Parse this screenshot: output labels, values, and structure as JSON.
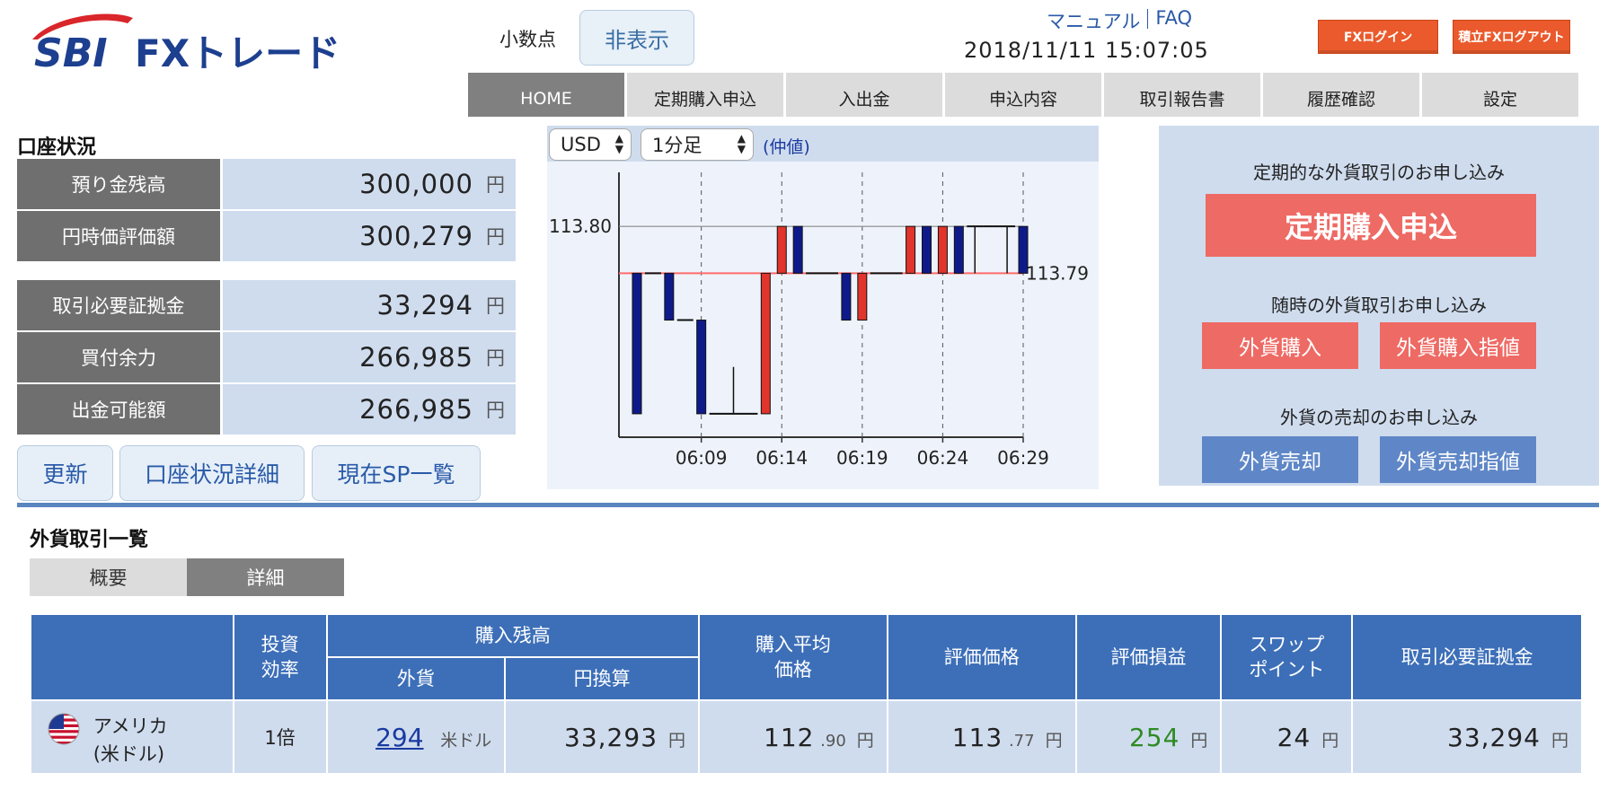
{
  "header": {
    "logo_sbi": "SBI",
    "logo_text": "FXトレード",
    "decimal_label": "小数点",
    "decimal_toggle": "非表示",
    "manual_link": "マニュアル",
    "faq_link": "FAQ",
    "datetime": "2018/11/11 15:07:05",
    "login_button": "FXログイン",
    "logout_button": "積立FXログアウト",
    "colors": {
      "brand_blue": "#1d3f8f",
      "brand_red": "#d9262a",
      "header_button": "#ea5a2c"
    }
  },
  "nav": {
    "tabs": [
      {
        "label": "HOME",
        "active": true
      },
      {
        "label": "定期購入申込",
        "active": false
      },
      {
        "label": "入出金",
        "active": false
      },
      {
        "label": "申込内容",
        "active": false
      },
      {
        "label": "取引報告書",
        "active": false
      },
      {
        "label": "履歴確認",
        "active": false
      },
      {
        "label": "設定",
        "active": false
      }
    ]
  },
  "account": {
    "title": "口座状況",
    "rows": [
      {
        "label": "預り金残高",
        "value": "300,000",
        "unit": "円"
      },
      {
        "label": "円時価評価額",
        "value": "300,279",
        "unit": "円"
      },
      {
        "label": "取引必要証拠金",
        "value": "33,294",
        "unit": "円"
      },
      {
        "label": "買付余力",
        "value": "266,985",
        "unit": "円"
      },
      {
        "label": "出金可能額",
        "value": "266,985",
        "unit": "円"
      }
    ],
    "buttons": {
      "refresh": "更新",
      "detail": "口座状況詳細",
      "sp_list": "現在SP一覧"
    }
  },
  "chart_controls": {
    "currency": "USD",
    "timeframe": "1分足",
    "price_type": "(仲値)"
  },
  "chart_data": {
    "type": "candlestick",
    "y_tick_label": "113.80",
    "current_price_label": "113.79",
    "current_price": 113.79,
    "x_tick_labels": [
      "06:09",
      "06:14",
      "06:19",
      "06:24",
      "06:29"
    ],
    "grid": "vertical dashed at x ticks",
    "colors": {
      "up": "#e0342c",
      "down": "#0f1a8a",
      "flat": "#111111",
      "current_line": "#ff6b6b"
    },
    "candles": [
      {
        "o": 113.79,
        "c": 113.76,
        "h": 113.79,
        "l": 113.76
      },
      {
        "o": 113.79,
        "c": 113.79,
        "h": 113.79,
        "l": 113.79
      },
      {
        "o": 113.79,
        "c": 113.78,
        "h": 113.79,
        "l": 113.78
      },
      {
        "o": 113.78,
        "c": 113.78,
        "h": 113.78,
        "l": 113.78
      },
      {
        "o": 113.78,
        "c": 113.76,
        "h": 113.78,
        "l": 113.76
      },
      {
        "o": 113.76,
        "c": 113.76,
        "h": 113.76,
        "l": 113.76
      },
      {
        "o": 113.76,
        "c": 113.76,
        "h": 113.77,
        "l": 113.76
      },
      {
        "o": 113.76,
        "c": 113.76,
        "h": 113.76,
        "l": 113.76
      },
      {
        "o": 113.76,
        "c": 113.79,
        "h": 113.79,
        "l": 113.76
      },
      {
        "o": 113.79,
        "c": 113.8,
        "h": 113.8,
        "l": 113.79
      },
      {
        "o": 113.8,
        "c": 113.79,
        "h": 113.8,
        "l": 113.79
      },
      {
        "o": 113.79,
        "c": 113.79,
        "h": 113.79,
        "l": 113.79
      },
      {
        "o": 113.79,
        "c": 113.79,
        "h": 113.79,
        "l": 113.79
      },
      {
        "o": 113.79,
        "c": 113.78,
        "h": 113.79,
        "l": 113.78
      },
      {
        "o": 113.78,
        "c": 113.79,
        "h": 113.79,
        "l": 113.78
      },
      {
        "o": 113.79,
        "c": 113.79,
        "h": 113.79,
        "l": 113.79
      },
      {
        "o": 113.79,
        "c": 113.79,
        "h": 113.79,
        "l": 113.79
      },
      {
        "o": 113.79,
        "c": 113.8,
        "h": 113.8,
        "l": 113.79
      },
      {
        "o": 113.8,
        "c": 113.79,
        "h": 113.8,
        "l": 113.79
      },
      {
        "o": 113.79,
        "c": 113.8,
        "h": 113.8,
        "l": 113.79
      },
      {
        "o": 113.8,
        "c": 113.79,
        "h": 113.8,
        "l": 113.79
      },
      {
        "o": 113.8,
        "c": 113.8,
        "h": 113.8,
        "l": 113.79
      },
      {
        "o": 113.8,
        "c": 113.8,
        "h": 113.8,
        "l": 113.8
      },
      {
        "o": 113.8,
        "c": 113.8,
        "h": 113.8,
        "l": 113.79
      },
      {
        "o": 113.8,
        "c": 113.79,
        "h": 113.8,
        "l": 113.79
      }
    ]
  },
  "order_panel": {
    "periodic_caption": "定期的な外貨取引のお申し込み",
    "periodic_button": "定期購入申込",
    "spot_caption": "随時の外貨取引お申し込み",
    "buy_button": "外貨購入",
    "buy_limit_button": "外貨購入指値",
    "sell_caption": "外貨の売却のお申し込み",
    "sell_button": "外貨売却",
    "sell_limit_button": "外貨売却指値"
  },
  "trades": {
    "title": "外貨取引一覧",
    "subtabs": {
      "summary": "概要",
      "detail": "詳細"
    },
    "headers": {
      "leverage_1": "投資",
      "leverage_2": "効率",
      "holdings": "購入残高",
      "foreign": "外貨",
      "jpy": "円換算",
      "avg_1": "購入平均",
      "avg_2": "価格",
      "valuation": "評価価格",
      "pnl": "評価損益",
      "swap_1": "スワップ",
      "swap_2": "ポイント",
      "margin": "取引必要証拠金"
    },
    "rows": [
      {
        "flag_icon": "us-flag-icon",
        "name_1": "アメリカ",
        "name_2": "(米ドル)",
        "leverage": "1倍",
        "foreign_amount": "294",
        "foreign_unit": "米ドル",
        "jpy_amount": "33,293",
        "avg_int": "112",
        "avg_dec": ".90",
        "val_int": "113",
        "val_dec": ".77",
        "pnl": "254",
        "swap": "24",
        "margin": "33,294",
        "unit": "円"
      }
    ]
  }
}
